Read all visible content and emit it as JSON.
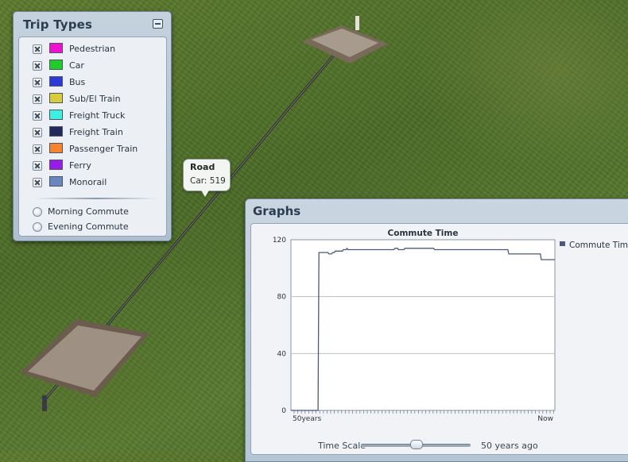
{
  "trip_types": {
    "title": "Trip Types",
    "items": [
      {
        "label": "Pedestrian",
        "color": "#f20fd0"
      },
      {
        "label": "Car",
        "color": "#1fcc2a"
      },
      {
        "label": "Bus",
        "color": "#2b3ad6"
      },
      {
        "label": "Sub/El Train",
        "color": "#d8cc3a"
      },
      {
        "label": "Freight Truck",
        "color": "#3ef0e0"
      },
      {
        "label": "Freight Train",
        "color": "#222a5c"
      },
      {
        "label": "Passenger Train",
        "color": "#f5842c"
      },
      {
        "label": "Ferry",
        "color": "#9a1ae8"
      },
      {
        "label": "Monorail",
        "color": "#6a86c0"
      }
    ],
    "commute_options": [
      "Morning Commute",
      "Evening Commute"
    ]
  },
  "tooltip": {
    "title": "Road",
    "value": "Car: 519"
  },
  "graphs": {
    "title": "Graphs",
    "time_scale_label": "Time Scale",
    "time_scale_value": "50 years ago",
    "time_scale_position": 0.5
  },
  "chart_data": {
    "type": "line",
    "title": "Commute Time",
    "xlabel": "",
    "ylabel": "",
    "x_tick_labels": [
      "50years",
      "Now"
    ],
    "y_ticks": [
      0,
      40,
      80,
      120
    ],
    "ylim": [
      0,
      120
    ],
    "legend": "top-right",
    "grid": true,
    "series": [
      {
        "name": "Commute Time",
        "color": "#4a5a78",
        "values": [
          0,
          0,
          0,
          0,
          0,
          0,
          0,
          0,
          0,
          0,
          0,
          0,
          0,
          0,
          0,
          0,
          0,
          0,
          0,
          0,
          0,
          0,
          0,
          0,
          0,
          0,
          0,
          0,
          0,
          0,
          0,
          111,
          111,
          111,
          111,
          111,
          111,
          111,
          111,
          111,
          111,
          111,
          110,
          110,
          110,
          110,
          111,
          111,
          111,
          112,
          112,
          112,
          112,
          112,
          112,
          112,
          112,
          112,
          113,
          113,
          113,
          113,
          114,
          113,
          113,
          113,
          113,
          113,
          113,
          113,
          113,
          113,
          113,
          113,
          113,
          113,
          113,
          113,
          113,
          113,
          113,
          113,
          113,
          113,
          113,
          113,
          113,
          113,
          113,
          113,
          113,
          113,
          113,
          113,
          113,
          113,
          113,
          113,
          113,
          113,
          113,
          113,
          113,
          113,
          113,
          113,
          113,
          113,
          113,
          113,
          113,
          113,
          113,
          113,
          113,
          114,
          114,
          114,
          114,
          113,
          113,
          113,
          113,
          113,
          113,
          113,
          114,
          114,
          114,
          114,
          114,
          114,
          114,
          114,
          114,
          114,
          114,
          114,
          114,
          114,
          114,
          114,
          114,
          114,
          114,
          114,
          114,
          114,
          114,
          114,
          114,
          114,
          114,
          114,
          114,
          114,
          114,
          114,
          114,
          113,
          113,
          113,
          113,
          113,
          113,
          113,
          113,
          113,
          113,
          113,
          113,
          113,
          113,
          113,
          113,
          113,
          113,
          113,
          113,
          113,
          113,
          113,
          113,
          113,
          113,
          113,
          113,
          113,
          113,
          113,
          113,
          113,
          113,
          113,
          113,
          113,
          113,
          113,
          113,
          113,
          113,
          113,
          113,
          113,
          113,
          113,
          113,
          113,
          113,
          113,
          113,
          113,
          113,
          113,
          113,
          113,
          113,
          113,
          113,
          113,
          113,
          113,
          113,
          113,
          113,
          113,
          113,
          113,
          113,
          113,
          113,
          113,
          113,
          113,
          113,
          113,
          113,
          113,
          113,
          113,
          113,
          110,
          110,
          110,
          110,
          110,
          110,
          110,
          110,
          110,
          110,
          110,
          110,
          110,
          110,
          110,
          110,
          110,
          110,
          110,
          110,
          110,
          110,
          110,
          110,
          110,
          110,
          110,
          110,
          110,
          110,
          110,
          110,
          110,
          110,
          110,
          110,
          106,
          106,
          106,
          106,
          106,
          106,
          106,
          106,
          106,
          106,
          106,
          106,
          106,
          106,
          106,
          106
        ]
      }
    ]
  }
}
